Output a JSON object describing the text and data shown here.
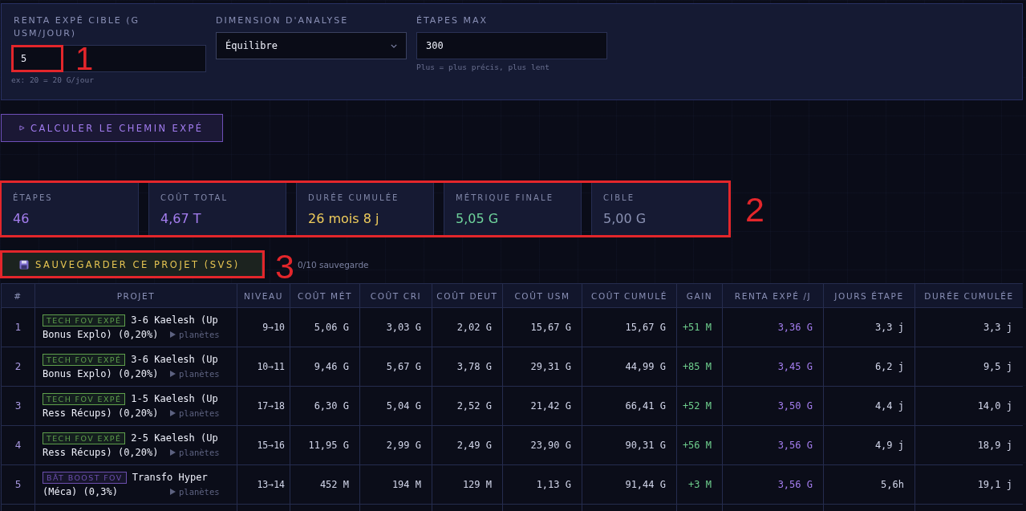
{
  "settings_panel": {
    "fields": [
      {
        "kind": "number",
        "label": "RENTA EXPÉ CIBLE (G USM/JOUR)",
        "value": "5",
        "hint": "ex: 20 = 20 G/jour",
        "annotation": "1"
      },
      {
        "kind": "select",
        "label": "DIMENSION D'ANALYSE",
        "value": "Équilibre"
      },
      {
        "kind": "number",
        "label": "ÉTAPES MAX",
        "value": "300",
        "hint": "Plus = plus précis, plus lent"
      }
    ]
  },
  "calculate_button": {
    "label": "CALCULER LE CHEMIN EXPÉ"
  },
  "summary": {
    "annotation": "2",
    "stats": [
      {
        "label": "ÉTAPES",
        "value": "46",
        "color": "#a57ef0"
      },
      {
        "label": "COÛT TOTAL",
        "value": "4,67 T",
        "color": "#a57ef0"
      },
      {
        "label": "DURÉE CUMULÉE",
        "value": "26 mois 8 j",
        "color": "#f0cd5c"
      },
      {
        "label": "MÉTRIQUE FINALE",
        "value": "5,05 G",
        "color": "#6fd49c"
      },
      {
        "label": "CIBLE",
        "value": "5,00 G",
        "color": "#8a91b2"
      }
    ]
  },
  "save": {
    "button": "SAUVEGARDER CE PROJET (SVS)",
    "count": "0/10 sauvegarde",
    "annotation": "3"
  },
  "table": {
    "columns": [
      "#",
      "PROJET",
      "NIVEAU",
      "COÛT MÉT",
      "COÛT CRI",
      "COÛT DEUT",
      "COÛT USM",
      "COÛT CUMULÉ",
      "GAIN",
      "RENTA EXPÉ /J",
      "JOURS ÉTAPE",
      "DURÉE CUMULÉE"
    ],
    "rows": [
      {
        "num": "1",
        "tag": {
          "label": "TECH FOV EXPÉ",
          "color": "#5e9f4c"
        },
        "name_lines": [
          "3-6 Kaelesh (Up",
          "Bonus Explo) (0,20%)"
        ],
        "planets": {
          "label": "planètes",
          "expanded": false
        },
        "niveau": "9→10",
        "cout_met": "5,06 G",
        "cout_cri": "3,03 G",
        "cout_deut": "2,02 G",
        "cout_usm": "15,67 G",
        "cout_cumule": "15,67 G",
        "gain": "+51 M",
        "renta": "3,36 G",
        "jours_etape": "3,3 j",
        "duree_cumulee": "3,3 j"
      },
      {
        "num": "2",
        "tag": {
          "label": "TECH FOV EXPÉ",
          "color": "#5e9f4c"
        },
        "name_lines": [
          "3-6 Kaelesh (Up",
          "Bonus Explo) (0,20%)"
        ],
        "planets": {
          "label": "planètes",
          "expanded": false
        },
        "niveau": "10→11",
        "cout_met": "9,46 G",
        "cout_cri": "5,67 G",
        "cout_deut": "3,78 G",
        "cout_usm": "29,31 G",
        "cout_cumule": "44,99 G",
        "gain": "+85 M",
        "renta": "3,45 G",
        "jours_etape": "6,2 j",
        "duree_cumulee": "9,5 j"
      },
      {
        "num": "3",
        "tag": {
          "label": "TECH FOV EXPÉ",
          "color": "#5e9f4c"
        },
        "name_lines": [
          "1-5 Kaelesh (Up",
          "Ress Récups) (0,20%)"
        ],
        "planets": {
          "label": "planètes",
          "expanded": false
        },
        "niveau": "17→18",
        "cout_met": "6,30 G",
        "cout_cri": "5,04 G",
        "cout_deut": "2,52 G",
        "cout_usm": "21,42 G",
        "cout_cumule": "66,41 G",
        "gain": "+52 M",
        "renta": "3,50 G",
        "jours_etape": "4,4 j",
        "duree_cumulee": "14,0 j"
      },
      {
        "num": "4",
        "tag": {
          "label": "TECH FOV EXPÉ",
          "color": "#5e9f4c"
        },
        "name_lines": [
          "2-5 Kaelesh (Up",
          "Ress Récups) (0,20%)"
        ],
        "planets": {
          "label": "planètes",
          "expanded": false
        },
        "niveau": "15→16",
        "cout_met": "11,95 G",
        "cout_cri": "2,99 G",
        "cout_deut": "2,49 G",
        "cout_usm": "23,90 G",
        "cout_cumule": "90,31 G",
        "gain": "+56 M",
        "renta": "3,56 G",
        "jours_etape": "4,9 j",
        "duree_cumulee": "18,9 j"
      },
      {
        "num": "5",
        "tag": {
          "label": "BÂT BOOST FOV",
          "color": "#6c4fae"
        },
        "name_lines": [
          "Transfo Hyper",
          "(Méca) (0,3%)"
        ],
        "planets": {
          "label": "planètes",
          "expanded": false
        },
        "niveau": "13→14",
        "cout_met": "452 M",
        "cout_cri": "194 M",
        "cout_deut": "129 M",
        "cout_usm": "1,13 G",
        "cout_cumule": "91,44 G",
        "gain": "+3 M",
        "renta": "3,56 G",
        "jours_etape": "5,6h",
        "duree_cumulee": "19,1 j"
      }
    ]
  }
}
